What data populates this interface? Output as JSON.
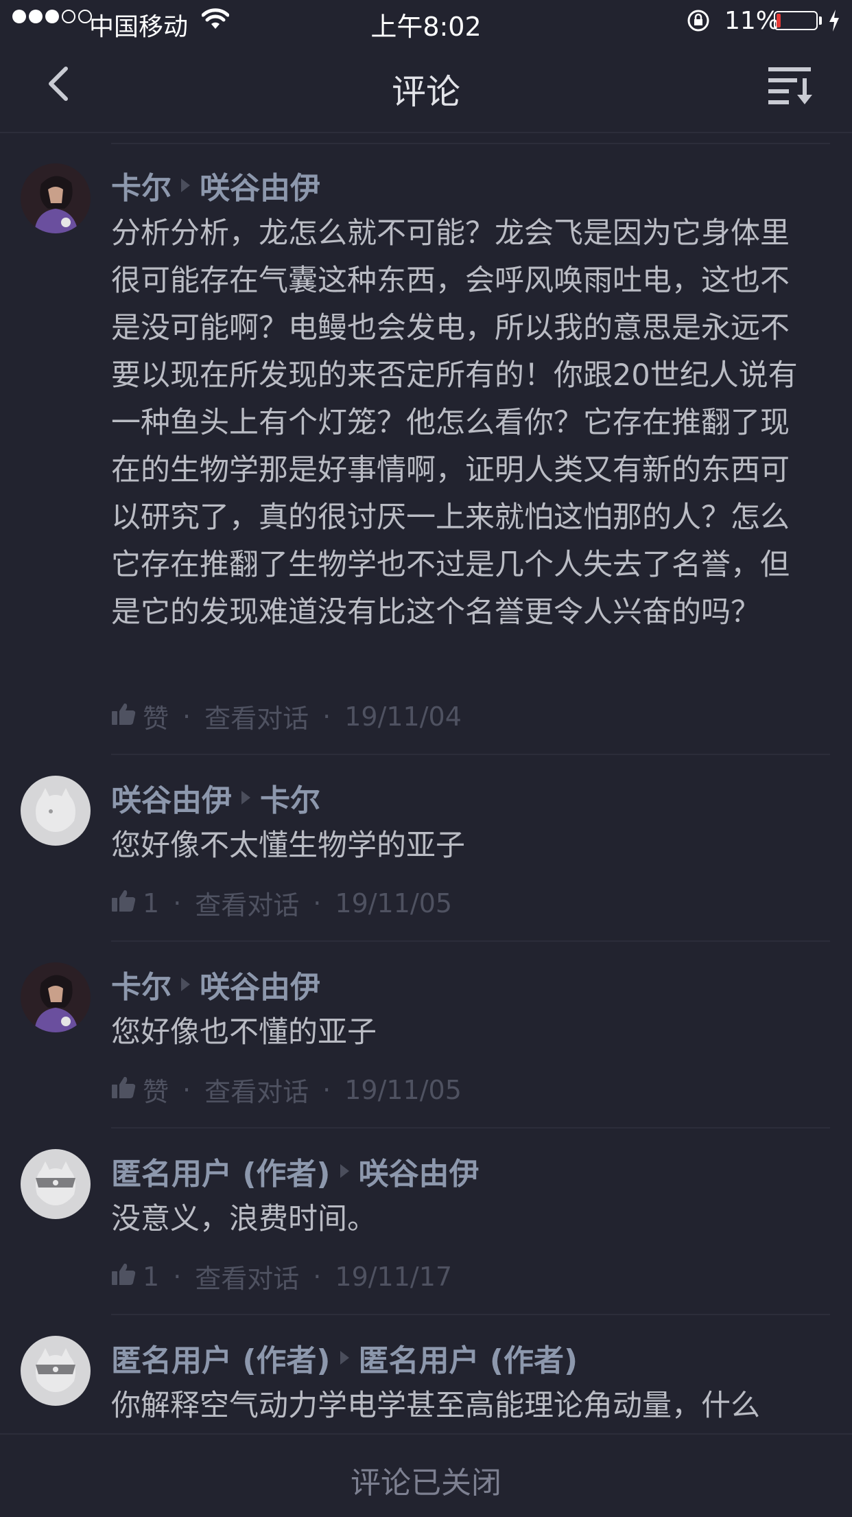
{
  "status_bar": {
    "carrier": "中国移动",
    "time": "上午8:02",
    "battery": "11%",
    "battery_level": 0.11,
    "signal_strength": 3
  },
  "nav": {
    "title": "评论"
  },
  "comments": [
    {
      "author": "卡尔",
      "reply_to": "咲谷由伊",
      "text": "分析分析，龙怎么就不可能？龙会飞是因为它身体里很可能存在气囊这种东西，会呼风唤雨吐电，这也不是没可能啊？电鳗也会发电，所以我的意思是永远不要以现在所发现的来否定所有的！你跟20世纪人说有一种鱼头上有个灯笼？他怎么看你？它存在推翻了现在的生物学那是好事情啊，证明人类又有新的东西可以研究了，真的很讨厌一上来就怕这怕那的人？怎么它存在推翻了生物学也不过是几个人失去了名誉，但是它的发现难道没有比这个名誉更令人兴奋的吗？",
      "likes": "赞",
      "view": "查看对话",
      "date": "19/11/04"
    },
    {
      "author": "咲谷由伊",
      "reply_to": "卡尔",
      "text": "您好像不太懂生物学的亚子",
      "likes": "1",
      "view": "查看对话",
      "date": "19/11/05"
    },
    {
      "author": "卡尔",
      "reply_to": "咲谷由伊",
      "text": "您好像也不懂的亚子",
      "likes": "赞",
      "view": "查看对话",
      "date": "19/11/05"
    },
    {
      "author": "匿名用户 (作者)",
      "reply_to": "咲谷由伊",
      "text": "没意义，浪费时间。",
      "likes": "1",
      "view": "查看对话",
      "date": "19/11/17"
    },
    {
      "author": "匿名用户 (作者)",
      "reply_to": "匿名用户 (作者)",
      "text": "你解释空气动力学电学甚至高能理论角动量，什么",
      "likes": "",
      "view": "",
      "date": ""
    }
  ],
  "footer": {
    "text": "评论已关闭"
  },
  "colors": {
    "background": "#22232f",
    "name": "#8d98ad",
    "body_text": "#babcc4",
    "meta": "#4f5261",
    "battery_low": "#e63935"
  }
}
